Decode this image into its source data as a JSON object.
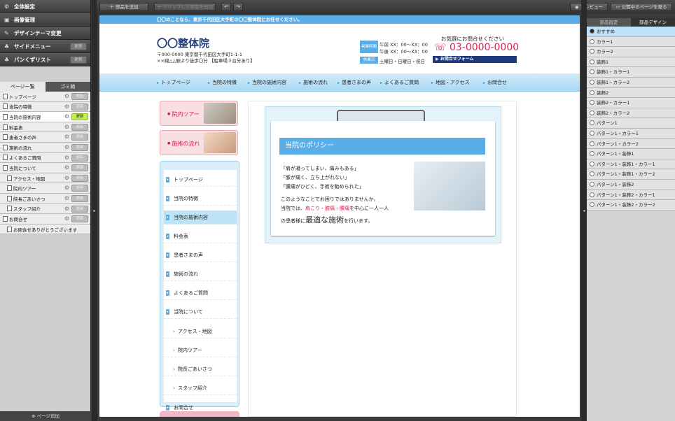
{
  "left_menu": [
    {
      "label": "全体設定",
      "icon": "gear-icon",
      "glyph": "⚙",
      "button": ""
    },
    {
      "label": "画像管理",
      "icon": "image-icon",
      "glyph": "▣",
      "button": ""
    },
    {
      "label": "デザインテーマ変更",
      "icon": "pencil-icon",
      "glyph": "✎",
      "button": ""
    },
    {
      "label": "サイドメニュー",
      "icon": "sitemap-icon",
      "glyph": "♣",
      "button": "更新"
    },
    {
      "label": "パンくずリスト",
      "icon": "sitemap-icon",
      "glyph": "♣",
      "button": "更新"
    }
  ],
  "left_tabs": [
    "ページ一覧",
    "ゴミ箱"
  ],
  "pages": [
    {
      "label": "トップページ",
      "sub": false,
      "sel": false
    },
    {
      "label": "当院の特徴",
      "sub": false,
      "sel": false
    },
    {
      "label": "当院の施術内容",
      "sub": false,
      "sel": true
    },
    {
      "label": "料金表",
      "sub": false,
      "sel": false
    },
    {
      "label": "患者さまの声",
      "sub": false,
      "sel": false
    },
    {
      "label": "施術の流れ",
      "sub": false,
      "sel": false
    },
    {
      "label": "よくあるご質問",
      "sub": false,
      "sel": false
    },
    {
      "label": "当院について",
      "sub": false,
      "sel": false
    },
    {
      "label": "アクセス・地図",
      "sub": true,
      "sel": false
    },
    {
      "label": "院内ツアー",
      "sub": true,
      "sel": false
    },
    {
      "label": "院長ごあいさつ",
      "sub": true,
      "sel": false
    },
    {
      "label": "スタッフ紹介",
      "sub": true,
      "sel": false
    },
    {
      "label": "お問合せ",
      "sub": false,
      "sel": false
    },
    {
      "label": "お問合せありがとうございます",
      "sub": true,
      "sel": false
    }
  ],
  "page_update_label": "更新",
  "add_page_label": "ページ追加",
  "toolbar": {
    "add": "部品を追加",
    "clip": "クリップした部品を追加",
    "undo": "↶",
    "redo": "↷",
    "preview": "プレビュー",
    "public": "公開中のページを見る"
  },
  "site": {
    "topstrip": "〇〇のことなら、東京千代田区大手町の〇〇整体院にお任せください。",
    "logo": "〇〇整体院",
    "addr1": "〒000-0000 東京都千代田区大手町1-1-1",
    "addr2": "××線△△駅より徒歩〇分 【駐車場３台分あり】",
    "hours_label": "営業時間",
    "hours_am": "午前 XX：00〜XX：00",
    "hours_pm": "午後 XX：00〜XX：00",
    "closed_label": "休業日",
    "closed": "土曜日・日曜日・祝日",
    "contact_title": "お気軽にお問合せください",
    "phone": "03-0000-0000",
    "form_btn": "お問合せフォーム",
    "nav": [
      "トップページ",
      "当院の特徴",
      "当院の施術内容",
      "施術の流れ",
      "患者さまの声",
      "よくあるご質問",
      "地図・アクセス",
      "お問合せ"
    ],
    "box1": "院内ツアー",
    "box2": "施術の流れ",
    "side_nav": [
      {
        "label": "トップページ",
        "sub": false,
        "hl": false
      },
      {
        "label": "当院の特徴",
        "sub": false,
        "hl": false
      },
      {
        "label": "当院の施術内容",
        "sub": false,
        "hl": true
      },
      {
        "label": "料金表",
        "sub": false,
        "hl": false
      },
      {
        "label": "患者さまの声",
        "sub": false,
        "hl": false
      },
      {
        "label": "施術の流れ",
        "sub": false,
        "hl": false
      },
      {
        "label": "よくあるご質問",
        "sub": false,
        "hl": false
      },
      {
        "label": "当院について",
        "sub": false,
        "hl": false
      },
      {
        "label": "アクセス・地図",
        "sub": true,
        "hl": false
      },
      {
        "label": "院内ツアー",
        "sub": true,
        "hl": false
      },
      {
        "label": "院長ごあいさつ",
        "sub": true,
        "hl": false
      },
      {
        "label": "スタッフ紹介",
        "sub": true,
        "hl": false
      },
      {
        "label": "お問合せ",
        "sub": false,
        "hl": false
      }
    ],
    "policy_title": "当院のポリシー",
    "policy_lines": [
      "「肩が凝ってしまい、痛みもある」",
      "「膝が痛く、立ち上がれない」",
      "「腰痛がひどく、手術を勧められた」"
    ],
    "policy_p1": "このようなことでお困りではありませんか。",
    "policy_p2a": "当院では、",
    "policy_p2b": "肩こり・膝痛・腰痛",
    "policy_p2c": "を中心に一人一人",
    "policy_p3a": "の患者様に",
    "policy_p3b": "最適な施術",
    "policy_p3c": "を行います。"
  },
  "right_tabs": [
    "部品設定",
    "部品デザイン"
  ],
  "designs": [
    "おすすめ",
    "カラー1",
    "カラー2",
    "装飾1",
    "装飾1・カラー1",
    "装飾1・カラー2",
    "装飾2",
    "装飾2・カラー1",
    "装飾2・カラー2",
    "パターン1",
    "パターン1・カラー1",
    "パターン1・カラー2",
    "パターン1・装飾1",
    "パターン1・装飾1・カラー1",
    "パターン1・装飾1・カラー2",
    "パターン1・装飾2",
    "パターン1・装飾2・カラー1",
    "パターン1・装飾2・カラー2"
  ],
  "colors": {
    "accent": "#5aaee8",
    "pink": "#d8234f",
    "navy": "#1f3a7a"
  }
}
